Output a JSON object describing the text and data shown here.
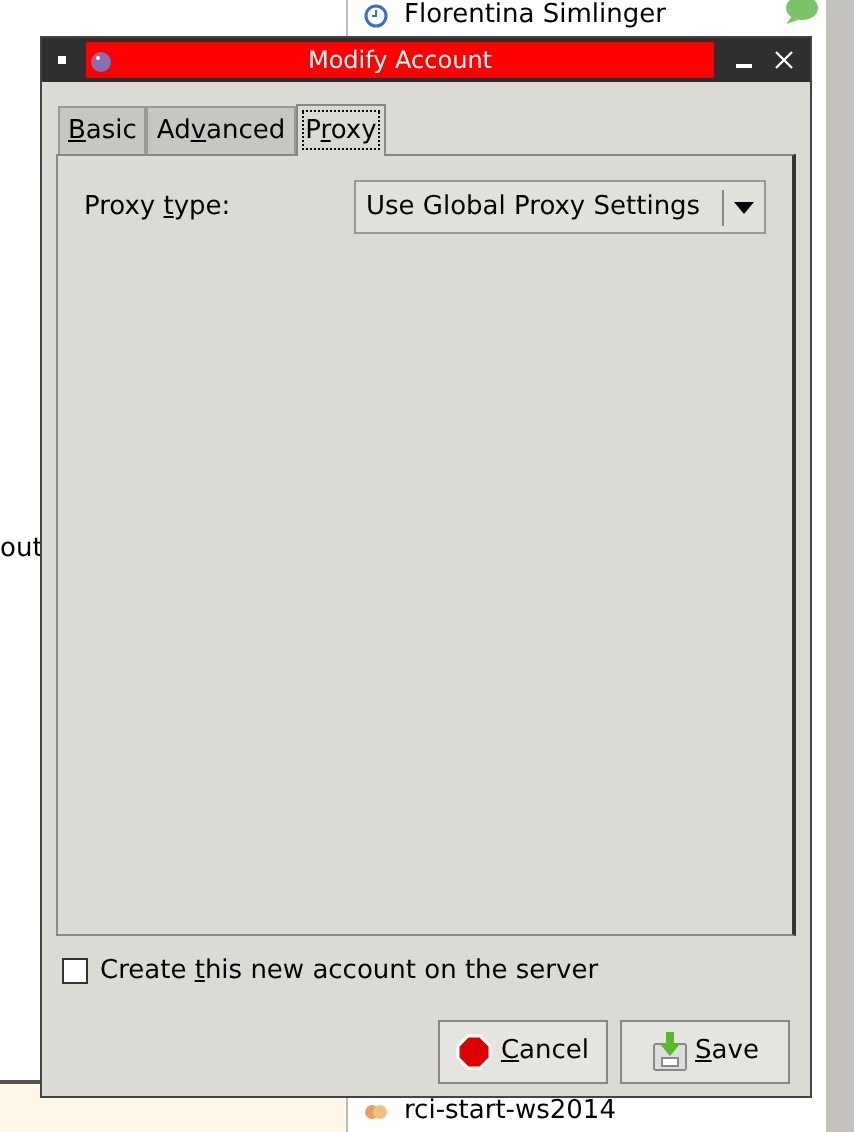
{
  "background": {
    "left_text": "out",
    "contacts": [
      {
        "name": "Florentina Simlinger",
        "kind": "person"
      },
      {
        "name": "rci-start-ws2014",
        "kind": "chat"
      }
    ]
  },
  "window": {
    "title": "Modify Account"
  },
  "tabs": [
    {
      "label": [
        {
          "text": "B",
          "underlined": true
        },
        {
          "text": "asic",
          "underlined": false
        }
      ],
      "selected": false
    },
    {
      "label": [
        {
          "text": "Ad",
          "underlined": false
        },
        {
          "text": "v",
          "underlined": true
        },
        {
          "text": "anced",
          "underlined": false
        }
      ],
      "selected": false
    },
    {
      "label": [
        {
          "text": "P",
          "underlined": false
        },
        {
          "text": "r",
          "underlined": true
        },
        {
          "text": "oxy",
          "underlined": false
        }
      ],
      "selected": true
    }
  ],
  "proxy": {
    "label": [
      {
        "text": "Proxy ",
        "underlined": false
      },
      {
        "text": "t",
        "underlined": true
      },
      {
        "text": "ype:",
        "underlined": false
      }
    ],
    "value": "Use Global Proxy Settings"
  },
  "create_on_server": {
    "label": [
      {
        "text": "Create ",
        "underlined": false
      },
      {
        "text": "t",
        "underlined": true
      },
      {
        "text": "his new account on the server",
        "underlined": false
      }
    ],
    "checked": false
  },
  "buttons": [
    {
      "label": [
        {
          "text": "C",
          "underlined": true
        },
        {
          "text": "ancel",
          "underlined": false
        }
      ],
      "kind": "cancel"
    },
    {
      "label": [
        {
          "text": "S",
          "underlined": true
        },
        {
          "text": "ave",
          "underlined": false
        }
      ],
      "kind": "save"
    }
  ]
}
